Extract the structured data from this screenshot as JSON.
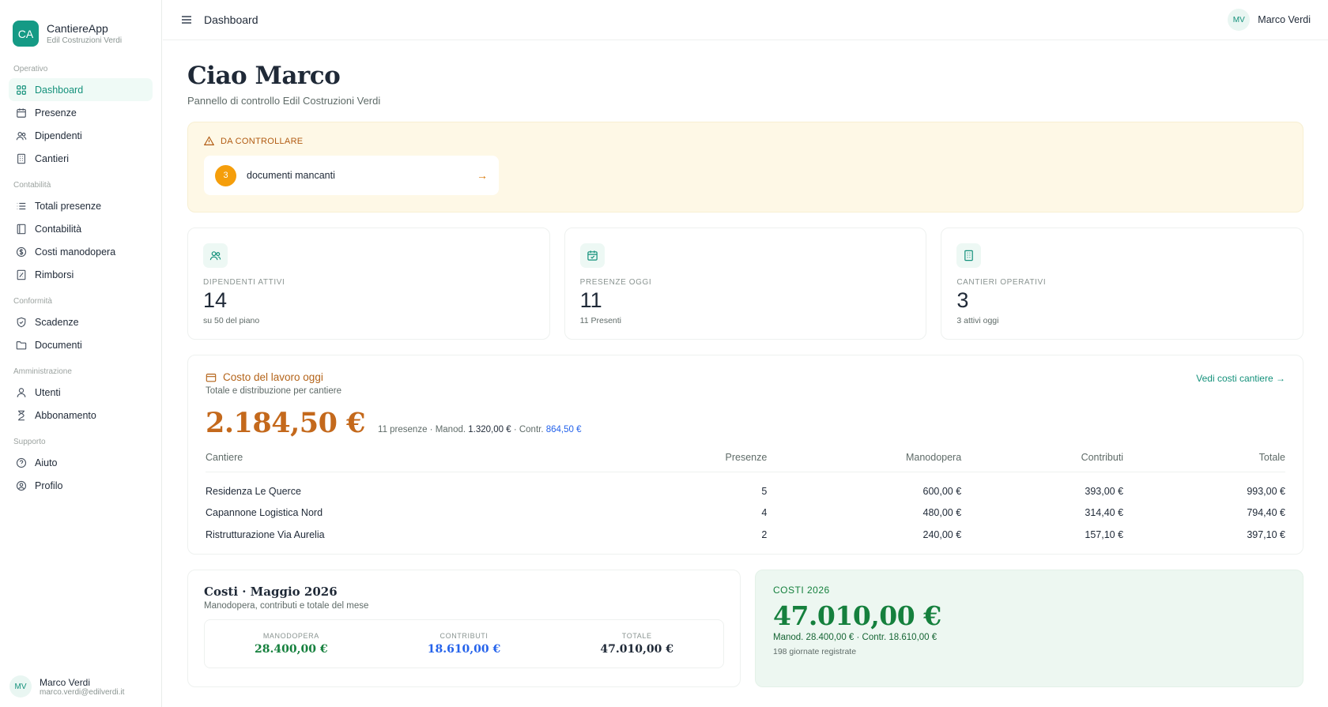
{
  "brand": {
    "logo": "CA",
    "name": "CantiereApp",
    "company": "Edil Costruzioni Verdi"
  },
  "sidebar": {
    "sections": [
      {
        "label": "Operativo",
        "items": [
          {
            "label": "Dashboard",
            "icon": "grid-icon",
            "active": true
          },
          {
            "label": "Presenze",
            "icon": "calendar-icon"
          },
          {
            "label": "Dipendenti",
            "icon": "users-icon"
          },
          {
            "label": "Cantieri",
            "icon": "building-icon"
          }
        ]
      },
      {
        "label": "Contabilità",
        "items": [
          {
            "label": "Totali presenze",
            "icon": "list-icon"
          },
          {
            "label": "Contabilità",
            "icon": "book-icon"
          },
          {
            "label": "Costi manodopera",
            "icon": "dollar-circle-icon"
          },
          {
            "label": "Rimborsi",
            "icon": "receipt-icon"
          }
        ]
      },
      {
        "label": "Conformità",
        "items": [
          {
            "label": "Scadenze",
            "icon": "shield-icon"
          },
          {
            "label": "Documenti",
            "icon": "folder-icon"
          }
        ]
      },
      {
        "label": "Amministrazione",
        "items": [
          {
            "label": "Utenti",
            "icon": "user-icon"
          },
          {
            "label": "Abbonamento",
            "icon": "hourglass-icon"
          }
        ]
      },
      {
        "label": "Supporto",
        "items": [
          {
            "label": "Aiuto",
            "icon": "help-circle-icon"
          },
          {
            "label": "Profilo",
            "icon": "profile-circle-icon"
          }
        ]
      }
    ],
    "user": {
      "initials": "MV",
      "name": "Marco Verdi",
      "email": "marco.verdi@edilverdi.it"
    }
  },
  "topbar": {
    "title": "Dashboard",
    "user_initials": "MV",
    "user_name": "Marco Verdi"
  },
  "header": {
    "greeting": "Ciao Marco",
    "subtitle": "Pannello di controllo Edil Costruzioni Verdi"
  },
  "alert": {
    "title": "DA CONTROLLARE",
    "count": "3",
    "text": "documenti mancanti"
  },
  "kpis": [
    {
      "icon": "users-icon",
      "label": "DIPENDENTI ATTIVI",
      "value": "14",
      "sub": "su 50 del piano"
    },
    {
      "icon": "calendar-icon",
      "label": "PRESENZE OGGI",
      "value": "11",
      "sub": "11 Presenti"
    },
    {
      "icon": "building-icon",
      "label": "CANTIERI OPERATIVI",
      "value": "3",
      "sub": "3 attivi oggi"
    }
  ],
  "labor_cost": {
    "title": "Costo del lavoro oggi",
    "subtitle": "Totale e distribuzione per cantiere",
    "link": "Vedi costi cantiere →",
    "total": "2.184,50 €",
    "meta_presenze": "11 presenze · Manod.",
    "meta_manod": "1.320,00 €",
    "meta_contr_label": "· Contr.",
    "meta_contr": "864,50 €",
    "columns": [
      "Cantiere",
      "Presenze",
      "Manodopera",
      "Contributi",
      "Totale"
    ],
    "rows": [
      [
        "Residenza Le Querce",
        "5",
        "600,00 €",
        "393,00 €",
        "993,00 €"
      ],
      [
        "Capannone Logistica Nord",
        "4",
        "480,00 €",
        "314,40 €",
        "794,40 €"
      ],
      [
        "Ristrutturazione Via Aurelia",
        "2",
        "240,00 €",
        "157,10 €",
        "397,10 €"
      ]
    ]
  },
  "month": {
    "title": "Costi · Maggio 2026",
    "subtitle": "Manodopera, contributi e totale del mese",
    "cols": [
      {
        "label": "MANODOPERA",
        "value": "28.400,00 €"
      },
      {
        "label": "CONTRIBUTI",
        "value": "18.610,00 €"
      },
      {
        "label": "TOTALE",
        "value": "47.010,00 €"
      }
    ]
  },
  "year": {
    "label": "COSTI 2026",
    "total": "47.010,00 €",
    "meta": "Manod. 28.400,00 € · Contr. 18.610,00 €",
    "foot": "198 giornate registrate"
  }
}
